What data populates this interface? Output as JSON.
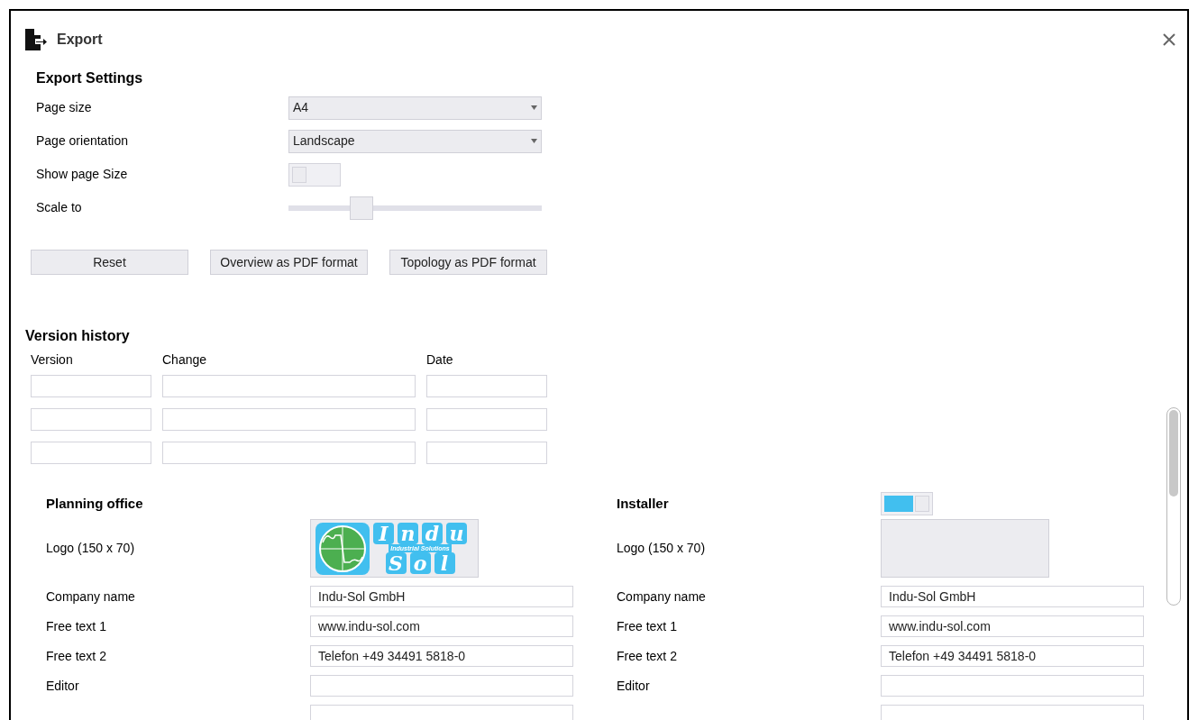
{
  "window": {
    "title": "Export"
  },
  "export_settings": {
    "title": "Export Settings",
    "rows": [
      {
        "kind": "dropdown",
        "label": "Page size",
        "value": "A4"
      },
      {
        "kind": "dropdown",
        "label": "Page orientation",
        "value": "Landscape"
      },
      {
        "kind": "toggle",
        "label": "Show page Size",
        "on": false
      },
      {
        "kind": "slider",
        "label": "Scale to",
        "level": 0.29
      }
    ],
    "buttons": [
      "Reset",
      "Overview as PDF format",
      "Topology as PDF format"
    ]
  },
  "version_history": {
    "title": "Version history",
    "columns": [
      "Version",
      "Change",
      "Date"
    ],
    "rows": [
      {},
      {},
      {}
    ]
  },
  "parties": [
    {
      "title": "Planning office",
      "logo_label": "Logo (150 x 70)",
      "logo": {
        "top": [
          "I",
          "n",
          "d",
          "u"
        ],
        "tagline": "Industrial Solutions",
        "bottom": [
          "S",
          "o",
          "l"
        ]
      },
      "fields": [
        {
          "kind": "labeled",
          "label": "Company name",
          "value": "Indu-Sol GmbH"
        },
        {
          "kind": "labeled",
          "label": "Free text 1",
          "value": "www.indu-sol.com"
        },
        {
          "kind": "labeled",
          "label": "Free text 2",
          "value": "Telefon +49 34491 5818-0"
        },
        {
          "kind": "labeled",
          "label": "Editor"
        },
        {
          "kind": "cut_off"
        }
      ]
    },
    {
      "title": "Installer",
      "toggle": {
        "on": true
      },
      "logo_label": "Logo (150 x 70)",
      "fields": [
        {
          "kind": "labeled",
          "label": "Company name",
          "value": "Indu-Sol GmbH"
        },
        {
          "kind": "labeled",
          "label": "Free text 1",
          "value": "www.indu-sol.com"
        },
        {
          "kind": "labeled",
          "label": "Free text 2",
          "value": "Telefon +49 34491 5818-0"
        },
        {
          "kind": "labeled",
          "label": "Editor"
        },
        {
          "kind": "cut_off"
        }
      ]
    }
  ]
}
